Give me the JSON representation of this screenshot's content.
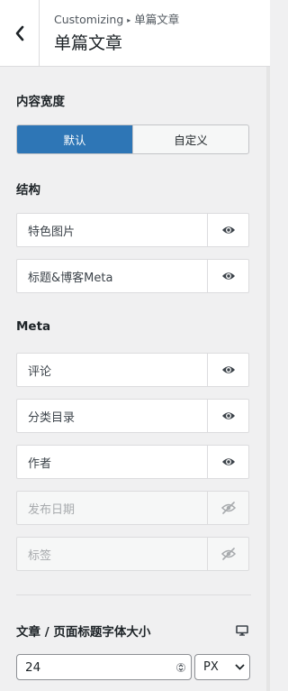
{
  "header": {
    "crumb_root": "Customizing",
    "crumb_sep": "▸",
    "crumb_current": "单篇文章",
    "title": "单篇文章"
  },
  "content_width": {
    "label": "内容宽度",
    "options": [
      "默认",
      "自定义"
    ],
    "selected": "默认"
  },
  "structure": {
    "label": "结构",
    "items": [
      {
        "label": "特色图片",
        "visible": true
      },
      {
        "label": "标题&博客Meta",
        "visible": true
      }
    ]
  },
  "meta": {
    "label": "Meta",
    "items": [
      {
        "label": "评论",
        "visible": true
      },
      {
        "label": "分类目录",
        "visible": true
      },
      {
        "label": "作者",
        "visible": true
      },
      {
        "label": "发布日期",
        "visible": false
      },
      {
        "label": "标签",
        "visible": false
      }
    ]
  },
  "font_size": {
    "label": "文章 / 页面标题字体大小",
    "value": "24",
    "unit": "PX",
    "device_icon": "desktop-icon"
  },
  "colors": {
    "accent": "#2e76b6"
  }
}
